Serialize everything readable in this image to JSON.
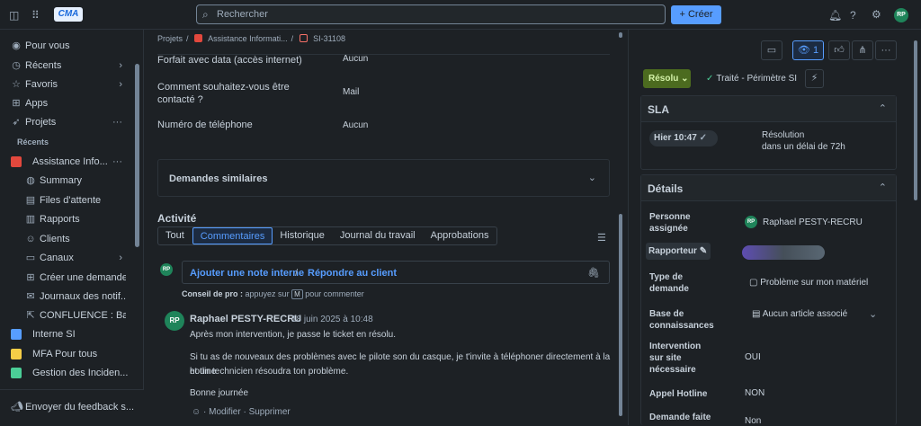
{
  "topbar": {
    "logo_text": "CMA",
    "search_placeholder": "Rechercher",
    "create_label": "+ Créer",
    "user_initials": "RP"
  },
  "sidebar": {
    "items": [
      {
        "label": "Pour vous",
        "icon": "user-circle-icon"
      },
      {
        "label": "Récents",
        "icon": "clock-icon"
      },
      {
        "label": "Favoris",
        "icon": "star-icon"
      },
      {
        "label": "Apps",
        "icon": "grid-icon"
      },
      {
        "label": "Projets",
        "icon": "rocket-icon"
      }
    ],
    "section_label": "Récents",
    "project": "Assistance Info...",
    "sub_items": [
      {
        "label": "Summary",
        "icon": "globe-icon"
      },
      {
        "label": "Files d'attente",
        "icon": "queue-icon"
      },
      {
        "label": "Rapports",
        "icon": "chart-icon"
      },
      {
        "label": "Clients",
        "icon": "person-icon"
      },
      {
        "label": "Canaux",
        "icon": "channels-icon"
      },
      {
        "label": "Créer une demande",
        "icon": "plus-square-icon"
      },
      {
        "label": "Journaux des notif...",
        "icon": "mail-icon"
      },
      {
        "label": "CONFLUENCE : Ba...",
        "icon": "external-link-icon"
      }
    ],
    "other_projects": [
      {
        "label": "Interne SI",
        "color": "#579dff"
      },
      {
        "label": "MFA Pour tous",
        "color": "#f5cd47"
      },
      {
        "label": "Gestion des Inciden...",
        "color": "#4bce97"
      }
    ],
    "feedback": "Envoyer du feedback s..."
  },
  "breadcrumb": [
    "Projets",
    "Assistance Informati...",
    "SI-31108"
  ],
  "fields": [
    {
      "label": "Forfait avec data (accès internet)",
      "value": "Aucun"
    },
    {
      "label": "Comment souhaitez-vous être contacté ?",
      "value": "Mail"
    },
    {
      "label": "Numéro de téléphone",
      "value": "Aucun"
    }
  ],
  "similar_requests": "Demandes similaires",
  "activity": {
    "title": "Activité",
    "tabs": [
      "Tout",
      "Commentaires",
      "Historique",
      "Journal du travail",
      "Approbations"
    ],
    "active_tab": "Commentaires",
    "add_internal_note": "Ajouter une note interne",
    "separator": "/",
    "reply_client": "Répondre au client",
    "tip_bold": "Conseil de pro :",
    "tip_text": "appuyez sur",
    "tip_key": "M",
    "tip_end": "pour commenter"
  },
  "comment": {
    "initials": "RP",
    "author": "Raphael PESTY-RECRU",
    "date": "18 juin 2025 à 10:48",
    "paragraphs": [
      "Après mon intervention, je passe le ticket en résolu.",
      "Si tu as de nouveaux des problèmes avec le pilote son du casque, je t'invite à téléphoner directement à la hotline",
      "et un technicien résoudra ton problème.",
      "Bonne journée"
    ],
    "actions": [
      "Modifier",
      "Supprimer"
    ]
  },
  "right": {
    "watch_count": "1",
    "status": "Résolu",
    "queue_label": "Traité - Périmètre SI",
    "sla": {
      "title": "SLA",
      "time": "Hier 10:47",
      "desc_line1": "Résolution",
      "desc_line2": "dans un délai de 72h"
    },
    "details": {
      "title": "Détails",
      "assignee_label_1": "Personne",
      "assignee_label_2": "assignée",
      "assignee": "Raphael PESTY-RECRU",
      "assignee_initials": "RP",
      "reporter_label": "Rapporteur",
      "type_label_1": "Type de",
      "type_label_2": "demande",
      "type_value": "Problème sur mon matériel",
      "kb_label_1": "Base de",
      "kb_label_2": "connaissances",
      "kb_value": "Aucun article associé",
      "intervention_label_1": "Intervention",
      "intervention_label_2": "sur site",
      "intervention_label_3": "nécessaire",
      "intervention_value": "OUI",
      "hotline_label": "Appel Hotline",
      "hotline_value": "NON",
      "demande_label": "Demande faite",
      "demande_value": "Non"
    }
  }
}
